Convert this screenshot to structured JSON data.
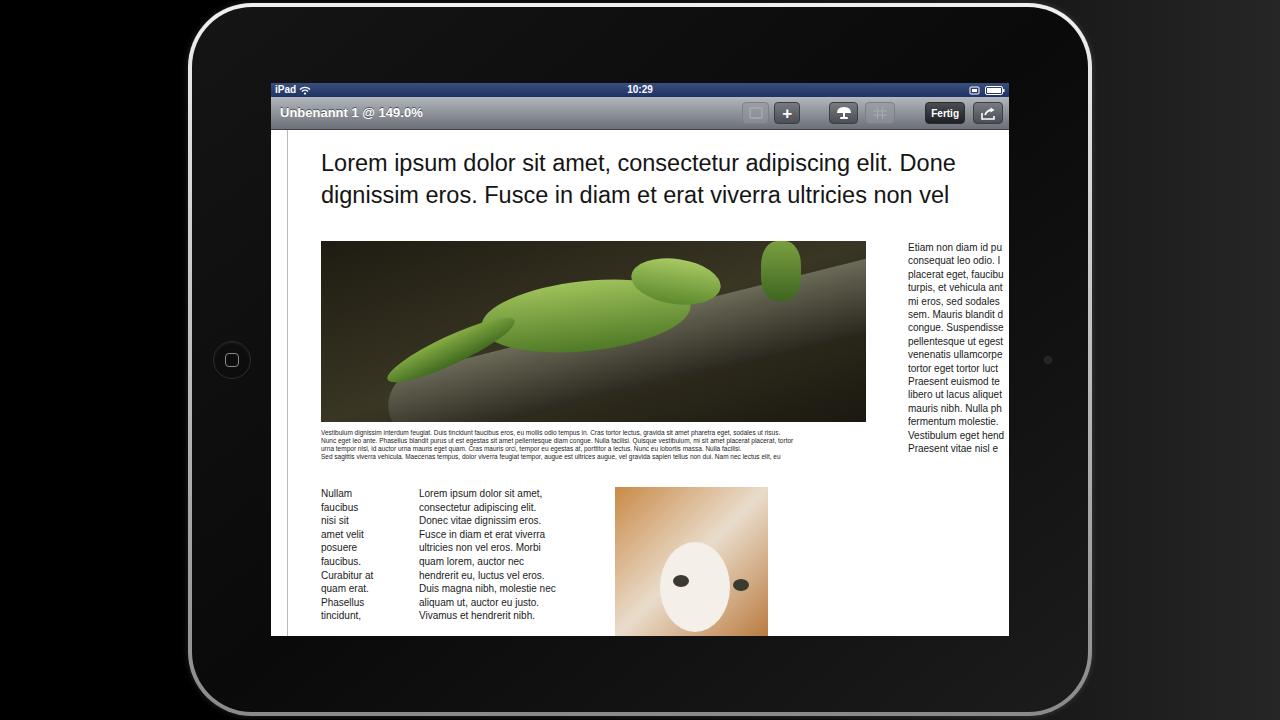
{
  "status_bar": {
    "device": "iPad",
    "time": "10:29"
  },
  "toolbar": {
    "title": "Unbenannt 1 @ 149.0%",
    "buttons": [
      {
        "kind": "media",
        "disabled": true
      },
      {
        "kind": "add",
        "label": "+",
        "disabled": false
      },
      {
        "kind": "tools",
        "disabled": false
      },
      {
        "kind": "grid",
        "disabled": true
      },
      {
        "kind": "done",
        "label": "Fertig",
        "disabled": false
      },
      {
        "kind": "share",
        "disabled": false
      }
    ]
  },
  "document": {
    "headline": [
      "Lorem ipsum dolor sit amet, consectetur adipiscing elit. Done",
      "dignissim eros. Fusce in diam et erat viverra ultricies non vel"
    ],
    "caption": [
      "Vestibulum dignissim interdum feugiat. Duis tincidunt faucibus eros, eu mollis odio tempus in. Cras tortor lectus, gravida sit amet pharetra eget, sodales ut risus.",
      "Nunc eget leo ante. Phasellus blandit purus ut est egestas sit amet pellentesque diam congue. Nulla facilisi. Quisque vestibulum, mi sit amet placerat placerat, tortor",
      "urna tempor nisl, id auctor urna mauris eget quam. Cras mauris orci, tempor eu egestas at, porttitor a lectus. Nunc eu lobortis massa. Nulla facilisi.",
      "Sed sagittis viverra vehicula. Maecenas tempus, dolor viverra feugiat tempor, augue est ultrices augue, vel gravida sapien tellus non dui. Nam nec lectus elit, eu"
    ],
    "sidebar": [
      "Etiam non diam id pu",
      "consequat leo odio. I",
      "placerat eget, faucibu",
      "turpis, et vehicula ant",
      "mi eros, sed sodales",
      "sem. Mauris blandit d",
      "congue. Suspendisse",
      "pellentesque ut egest",
      "venenatis ullamcorpe",
      "tortor eget tortor luct",
      "Praesent euismod te",
      "libero ut lacus aliquet",
      "mauris nibh. Nulla ph",
      "fermentum molestie.",
      "Vestibulum eget hend",
      "Praesent vitae nisl e"
    ],
    "column1": [
      "Nullam",
      "faucibus",
      "nisi sit",
      "amet velit",
      "posuere",
      "faucibus.",
      "Curabitur at",
      "quam erat.",
      "Phasellus",
      "tincidunt,"
    ],
    "column2": [
      "Lorem ipsum dolor sit amet,",
      "consectetur adipiscing elit.",
      "Donec vitae dignissim eros.",
      "Fusce in diam et erat viverra",
      "ultricies non vel eros. Morbi",
      "quam lorem, auctor nec",
      "hendrerit eu, luctus vel eros.",
      "Duis magna nibh, molestie nec",
      "aliquam ut, auctor eu justo.",
      "Vivamus et hendrerit nibh."
    ]
  }
}
